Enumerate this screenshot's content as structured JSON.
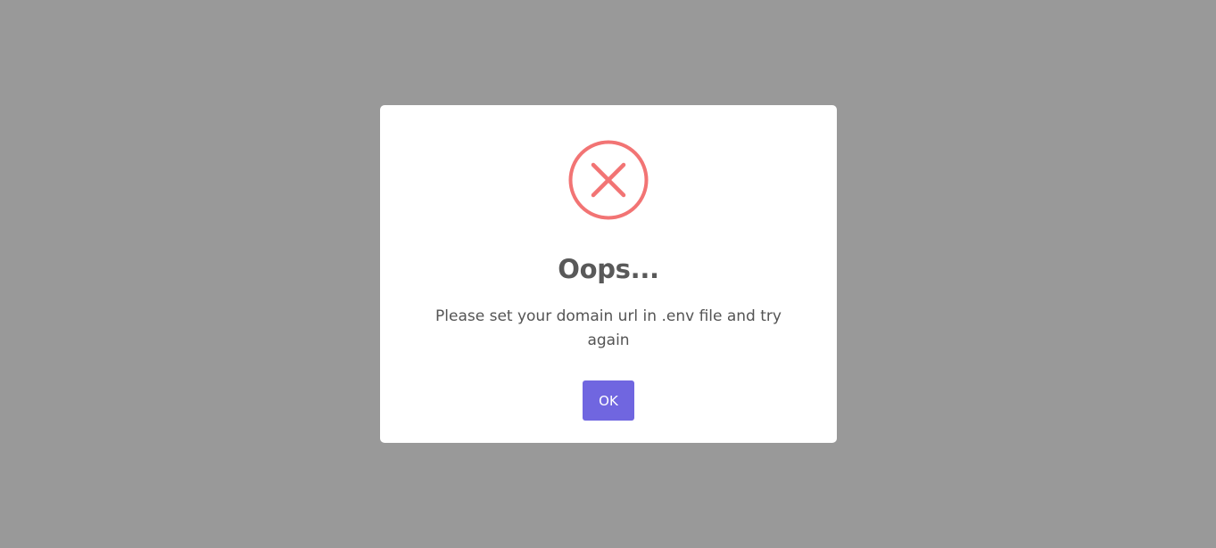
{
  "dialog": {
    "title": "Oops...",
    "message": "Please set your domain url in .env file and try again",
    "confirm_label": "OK",
    "icon": "error-x-icon"
  },
  "colors": {
    "overlay": "#999999",
    "error_red": "#f27474",
    "confirm_button": "#7066e0",
    "title_text": "#595959",
    "message_text": "#545454"
  }
}
